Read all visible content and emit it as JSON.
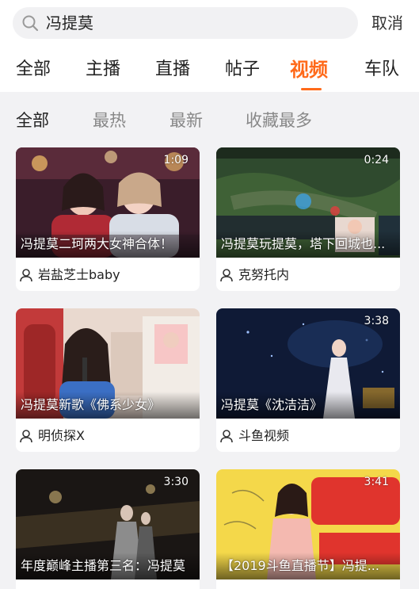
{
  "search": {
    "query": "冯提莫",
    "cancel_label": "取消"
  },
  "tabs": [
    {
      "label": "全部"
    },
    {
      "label": "主播"
    },
    {
      "label": "直播"
    },
    {
      "label": "帖子"
    },
    {
      "label": "视频",
      "active": true
    },
    {
      "label": "车队"
    }
  ],
  "filters": [
    {
      "label": "全部",
      "active": true
    },
    {
      "label": "最热"
    },
    {
      "label": "最新"
    },
    {
      "label": "收藏最多"
    }
  ],
  "videos": [
    {
      "duration": "1:09",
      "title": "冯提莫二珂两大女神合体！",
      "author": "岩盐芝士baby"
    },
    {
      "duration": "0:24",
      "title": "冯提莫玩提莫，塔下回城也...",
      "author": "克努托内"
    },
    {
      "duration": "",
      "title": "冯提莫新歌《佛系少女》",
      "author": "明侦探X"
    },
    {
      "duration": "3:38",
      "title": "冯提莫《沈洁洁》",
      "author": "斗鱼视频"
    },
    {
      "duration": "3:30",
      "title": "年度巅峰主播第三名：冯提莫",
      "author": ""
    },
    {
      "duration": "3:41",
      "title": "【2019斗鱼直播节】冯提...",
      "author": ""
    }
  ],
  "colors": {
    "accent": "#ff6a1a",
    "page_bg": "#f2f2f4"
  },
  "icons": {
    "search": "search-icon",
    "user": "user-icon"
  }
}
